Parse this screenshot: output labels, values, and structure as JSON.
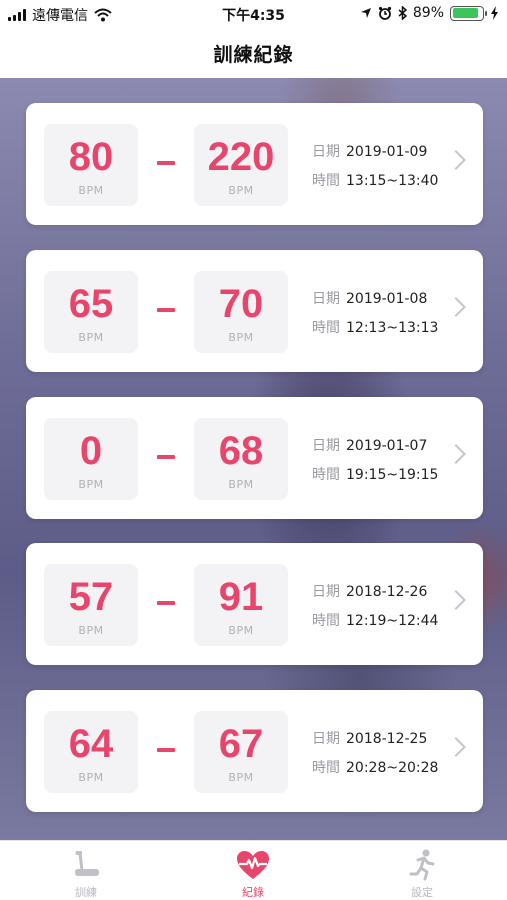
{
  "status_bar": {
    "carrier": "遠傳電信",
    "time": "下午4:35",
    "battery_percent": "89%",
    "battery_level": 0.89
  },
  "nav": {
    "title": "訓練紀錄"
  },
  "labels": {
    "bpm_unit": "BPM",
    "date_label": "日期",
    "time_label": "時間"
  },
  "records": [
    {
      "low": "80",
      "high": "220",
      "date": "2019-01-09",
      "time_range": "13:15~13:40"
    },
    {
      "low": "65",
      "high": "70",
      "date": "2019-01-08",
      "time_range": "12:13~13:13"
    },
    {
      "low": "0",
      "high": "68",
      "date": "2019-01-07",
      "time_range": "19:15~19:15"
    },
    {
      "low": "57",
      "high": "91",
      "date": "2018-12-26",
      "time_range": "12:19~12:44"
    },
    {
      "low": "64",
      "high": "67",
      "date": "2018-12-25",
      "time_range": "20:28~20:28"
    }
  ],
  "tabs": [
    {
      "label": "訓練",
      "icon": "treadmill-icon",
      "active": false
    },
    {
      "label": "紀錄",
      "icon": "heart-pulse-icon",
      "active": true
    },
    {
      "label": "設定",
      "icon": "runner-icon",
      "active": false
    }
  ],
  "colors": {
    "accent": "#e8456d",
    "inactive": "#c0c0c8"
  }
}
